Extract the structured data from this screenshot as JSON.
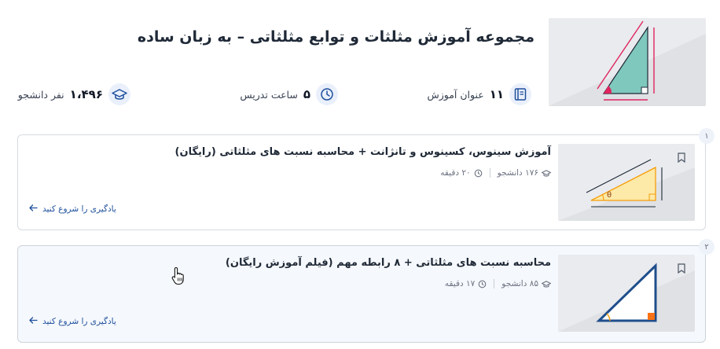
{
  "course": {
    "title": "مجموعه آموزش مثلثات و توابع مثلثاتی – به زبان ساده",
    "thumbnail_icon": "right-triangle-illustration"
  },
  "stats": {
    "lessons": {
      "value": "۱۱",
      "label": "عنوان آموزش",
      "icon": "book-icon"
    },
    "hours": {
      "value": "۵",
      "label": "ساعت تدریس",
      "icon": "clock-icon"
    },
    "students": {
      "value": "۱،۴۹۶",
      "label": "نفر دانشجو",
      "icon": "graduation-cap-icon"
    }
  },
  "lessons": [
    {
      "number": "۱",
      "title": "آموزش سینوس، کسینوس و تانژانت + محاسبه نسبت های مثلثاتی (رایگان)",
      "students": "۱۷۶ دانشجو",
      "duration": "۲۰ دقیقه",
      "cta": "یادگیری را شروع کنید"
    },
    {
      "number": "۲",
      "title": "محاسبه نسبت های مثلثاتی + ۸ رابطه مهم (فیلم آموزش رایگان)",
      "students": "۸۵ دانشجو",
      "duration": "۱۷ دقیقه",
      "cta": "یادگیری را شروع کنید"
    }
  ],
  "colors": {
    "accent": "#1e4f9c",
    "icon_bg": "#eaf0fb",
    "card_border": "#d6dae0",
    "triangle_fill": "#7fc8bd",
    "triangle_pink": "#e0245e",
    "lesson1_triangle": "#fde9a8",
    "lesson2_triangle": "#1f4e8c"
  }
}
